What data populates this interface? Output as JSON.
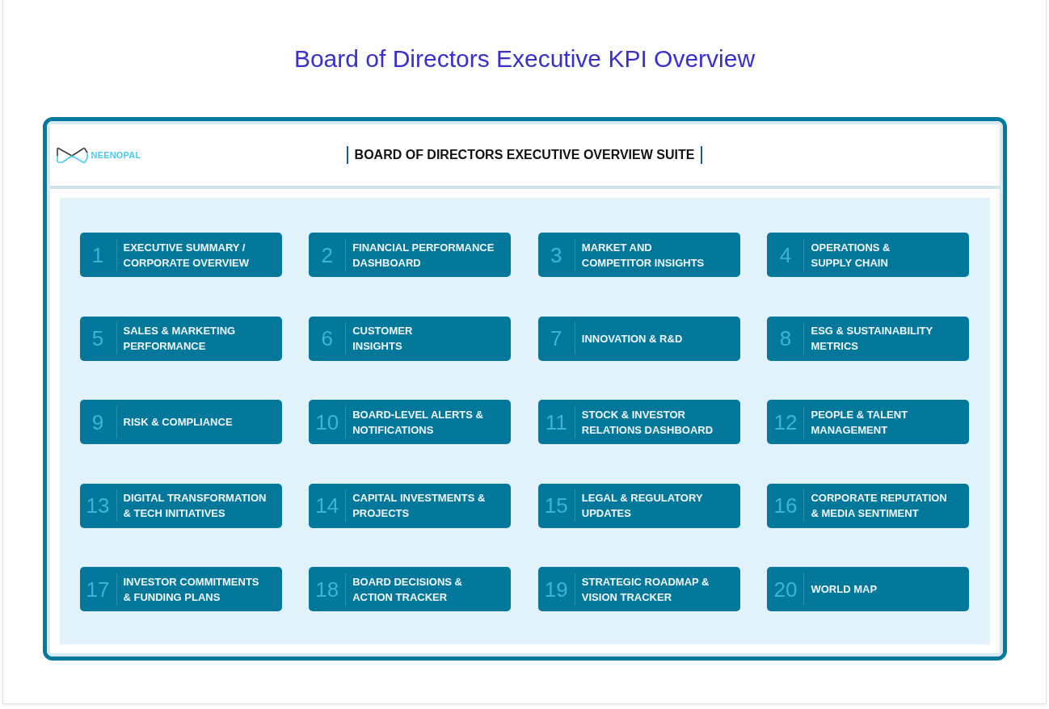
{
  "page_title": "Board of Directors Executive KPI Overview",
  "dashboard": {
    "logo_text": "NEENOPAL",
    "title": "BOARD OF DIRECTORS EXECUTIVE OVERVIEW SUITE",
    "tiles": [
      {
        "number": "1",
        "label_lines": [
          "EXECUTIVE SUMMARY /",
          "CORPORATE OVERVIEW"
        ]
      },
      {
        "number": "2",
        "label_lines": [
          "FINANCIAL PERFORMANCE",
          "DASHBOARD"
        ]
      },
      {
        "number": "3",
        "label_lines": [
          "MARKET AND",
          "COMPETITOR INSIGHTS"
        ]
      },
      {
        "number": "4",
        "label_lines": [
          "OPERATIONS &",
          "SUPPLY CHAIN"
        ]
      },
      {
        "number": "5",
        "label_lines": [
          "SALES & MARKETING",
          "PERFORMANCE"
        ]
      },
      {
        "number": "6",
        "label_lines": [
          "CUSTOMER",
          "INSIGHTS"
        ]
      },
      {
        "number": "7",
        "label_lines": [
          "INNOVATION & R&D"
        ]
      },
      {
        "number": "8",
        "label_lines": [
          "ESG & SUSTAINABILITY",
          "METRICS"
        ]
      },
      {
        "number": "9",
        "label_lines": [
          "RISK & COMPLIANCE"
        ]
      },
      {
        "number": "10",
        "label_lines": [
          "BOARD-LEVEL ALERTS &",
          "NOTIFICATIONS"
        ]
      },
      {
        "number": "11",
        "label_lines": [
          "STOCK & INVESTOR",
          "RELATIONS DASHBOARD"
        ]
      },
      {
        "number": "12",
        "label_lines": [
          "PEOPLE & TALENT",
          "MANAGEMENT"
        ]
      },
      {
        "number": "13",
        "label_lines": [
          "DIGITAL TRANSFORMATION",
          "& TECH INITIATIVES"
        ]
      },
      {
        "number": "14",
        "label_lines": [
          "CAPITAL INVESTMENTS &",
          "PROJECTS"
        ]
      },
      {
        "number": "15",
        "label_lines": [
          "LEGAL & REGULATORY",
          "UPDATES"
        ]
      },
      {
        "number": "16",
        "label_lines": [
          "CORPORATE REPUTATION",
          "& MEDIA SENTIMENT"
        ]
      },
      {
        "number": "17",
        "label_lines": [
          "INVESTOR COMMITMENTS",
          "& FUNDING PLANS"
        ]
      },
      {
        "number": "18",
        "label_lines": [
          "BOARD DECISIONS &",
          "ACTION TRACKER"
        ]
      },
      {
        "number": "19",
        "label_lines": [
          "STRATEGIC ROADMAP &",
          "VISION TRACKER"
        ]
      },
      {
        "number": "20",
        "label_lines": [
          "WORLD MAP"
        ]
      }
    ]
  }
}
